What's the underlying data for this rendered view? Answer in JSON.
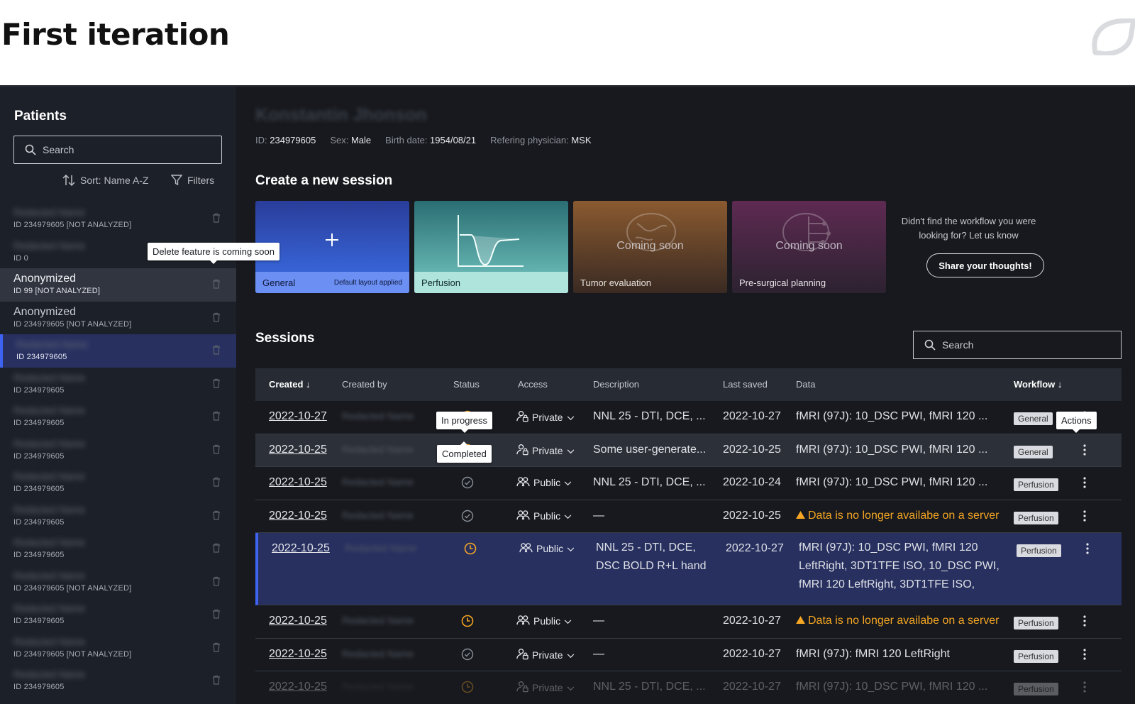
{
  "slide": {
    "title": "First iteration"
  },
  "sidebar": {
    "title": "Patients",
    "search_placeholder": "Search",
    "sort_label": "Sort: Name A-Z",
    "filters_label": "Filters",
    "delete_tooltip": "Delete feature is coming soon",
    "patients": [
      {
        "name": "",
        "id": "ID 234979605  [NOT ANALYZED]"
      },
      {
        "name": "",
        "id": "ID 0"
      },
      {
        "name": "Anonymized",
        "id": "ID 99  [NOT ANALYZED]"
      },
      {
        "name": "Anonymized",
        "id": "ID 234979605  [NOT ANALYZED]"
      },
      {
        "name": "",
        "id": "ID 234979605"
      },
      {
        "name": "",
        "id": "ID 234979605"
      },
      {
        "name": "",
        "id": "ID 234979605"
      },
      {
        "name": "",
        "id": "ID 234979605"
      },
      {
        "name": "",
        "id": "ID 234979605"
      },
      {
        "name": "",
        "id": "ID 234979605"
      },
      {
        "name": "",
        "id": "ID 234979605"
      },
      {
        "name": "",
        "id": "ID 234979605  [NOT ANALYZED]"
      },
      {
        "name": "",
        "id": "ID 234979605"
      },
      {
        "name": "",
        "id": "ID 234979605  [NOT ANALYZED]"
      },
      {
        "name": "",
        "id": "ID 234979605"
      }
    ]
  },
  "patient": {
    "id_label": "ID:",
    "id": "234979605",
    "sex_label": "Sex:",
    "sex": "Male",
    "birth_label": "Birth date:",
    "birth": "1954/08/21",
    "physician_label": "Refering physician:",
    "physician": "MSK"
  },
  "create": {
    "heading": "Create a new session",
    "cards": [
      {
        "label": "General",
        "note": "Default layout applied"
      },
      {
        "label": "Perfusion"
      },
      {
        "label": "Tumor evaluation",
        "soon": "Coming soon"
      },
      {
        "label": "Pre-surgical planning",
        "soon": "Coming soon"
      }
    ],
    "feedback_text": "Didn't find the workflow you were looking for? Let us know",
    "share_button": "Share your thoughts!"
  },
  "sessions": {
    "heading": "Sessions",
    "search_placeholder": "Search",
    "columns": {
      "created": "Created",
      "created_by": "Created by",
      "status": "Status",
      "access": "Access",
      "description": "Description",
      "last_saved": "Last saved",
      "data": "Data",
      "workflow": "Workflow"
    },
    "tooltips": {
      "in_progress": "In progress",
      "completed": "Completed",
      "actions": "Actions"
    },
    "rows": [
      {
        "created": "2022-10-27",
        "status": "in-progress",
        "access": "Private",
        "desc": "NNL 25 - DTI, DCE, ...",
        "saved": "2022-10-27",
        "data": "fMRI (97J): 10_DSC PWI, fMRI 120 ...",
        "workflow": "General"
      },
      {
        "created": "2022-10-25",
        "status": "in-progress",
        "access": "Private",
        "desc": "Some user-generate...",
        "saved": "2022-10-25",
        "data": "fMRI (97J): 10_DSC PWI, fMRI 120 ...",
        "workflow": "General"
      },
      {
        "created": "2022-10-25",
        "status": "completed",
        "access": "Public",
        "desc": "NNL 25 - DTI, DCE, ...",
        "saved": "2022-10-24",
        "data": "fMRI (97J): 10_DSC PWI, fMRI 120 ...",
        "workflow": "Perfusion"
      },
      {
        "created": "2022-10-25",
        "status": "completed",
        "access": "Public",
        "desc": "—",
        "saved": "2022-10-25",
        "data": "Data is no longer availabe on a server",
        "workflow": "Perfusion"
      },
      {
        "created": "2022-10-25",
        "status": "in-progress",
        "access": "Public",
        "desc_lines": [
          "NNL 25 - DTI, DCE,",
          "DSC BOLD R+L hand"
        ],
        "saved": "2022-10-27",
        "data_lines": [
          "fMRI (97J): 10_DSC PWI, fMRI 120",
          "LeftRight, 3DT1TFE ISO, 10_DSC PWI,",
          "fMRI 120 LeftRight, 3DT1TFE ISO,"
        ],
        "workflow": "Perfusion"
      },
      {
        "created": "2022-10-25",
        "status": "in-progress",
        "access": "Public",
        "desc": "—",
        "saved": "2022-10-27",
        "data": "Data is no longer availabe on a server",
        "workflow": "Perfusion"
      },
      {
        "created": "2022-10-25",
        "status": "completed",
        "access": "Private",
        "desc": "—",
        "saved": "2022-10-27",
        "data": "fMRI (97J): fMRI 120 LeftRight",
        "workflow": "Perfusion"
      },
      {
        "created": "2022-10-25",
        "status": "in-progress",
        "access": "Private",
        "desc": "NNL 25 - DTI, DCE, ...",
        "saved": "2022-10-27",
        "data": "fMRI (97J): 10_DSC PWI, fMRI 120 ...",
        "workflow": "Perfusion"
      }
    ]
  },
  "colors": {
    "accent": "#3d63f0",
    "warning": "#f5a623",
    "selected_row": "#283060"
  }
}
